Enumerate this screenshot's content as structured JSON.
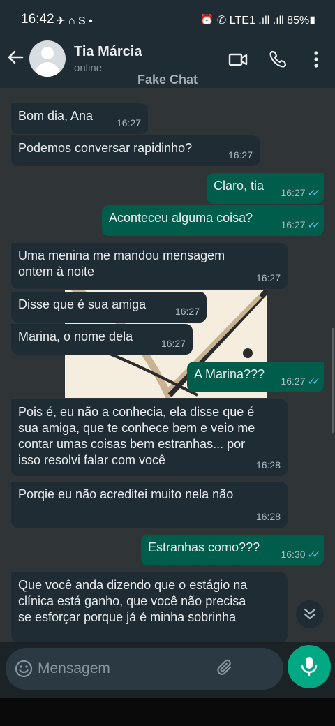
{
  "status_bar": {
    "time": "16:42",
    "left_icons": "✈ ⌂ S •",
    "right_icons": "⏰ ✆ LTE1 .ıll .ıll 85%▮"
  },
  "header": {
    "contact_name": "Tia Márcia",
    "status": "online",
    "watermark": "Fake Chat",
    "icons": [
      "back-arrow-icon",
      "video-call-icon",
      "phone-icon",
      "more-vert-icon"
    ]
  },
  "messages": [
    {
      "dir": "in",
      "text": "Bom dia, Ana",
      "time": "16:27"
    },
    {
      "dir": "in",
      "text": "Podemos conversar rapidinho?",
      "time": "16:27"
    },
    {
      "dir": "out",
      "text": "Claro, tia",
      "time": "16:27",
      "ticks": "✓✓"
    },
    {
      "dir": "out",
      "text": "Aconteceu alguma coisa?",
      "time": "16:27",
      "ticks": "✓✓"
    },
    {
      "dir": "in",
      "lines": [
        "Uma menina me mandou mensagem",
        "ontem à noite"
      ],
      "time": "16:27"
    },
    {
      "dir": "in",
      "text": "Disse que é sua amiga",
      "time": "16:27"
    },
    {
      "dir": "in",
      "text": "Marina, o nome dela",
      "time": "16:27"
    },
    {
      "dir": "out",
      "text": "A Marina???",
      "time": "16:27",
      "ticks": "✓✓"
    },
    {
      "dir": "in",
      "lines": [
        "Pois é, eu não a conhecia, ela disse que é",
        "sua amiga, que te conhece bem e veio me",
        "contar umas coisas bem estranhas... por",
        "isso resolvi falar com você"
      ],
      "time": "16:28"
    },
    {
      "dir": "in",
      "text": "Porqie eu não acreditei muito nela não",
      "time": "16:28"
    },
    {
      "dir": "out",
      "text": "Estranhas como???",
      "time": "16:30",
      "ticks": "✓✓"
    },
    {
      "dir": "in",
      "lines": [
        "Que você anda dizendo que o estágio na",
        "clínica está ganho, que você não precisa",
        "se esforçar porque já é minha sobrinha"
      ]
    }
  ],
  "composer": {
    "placeholder": "Mensagem",
    "icons": [
      "emoji-icon",
      "attach-icon",
      "mic-icon"
    ]
  },
  "colors": {
    "header_bg": "#202c33",
    "chat_bg": "#2f3436",
    "incoming_bubble": "#202c33",
    "outgoing_bubble": "#005c4b",
    "accent": "#00a884",
    "read_ticks": "#53bdeb"
  }
}
